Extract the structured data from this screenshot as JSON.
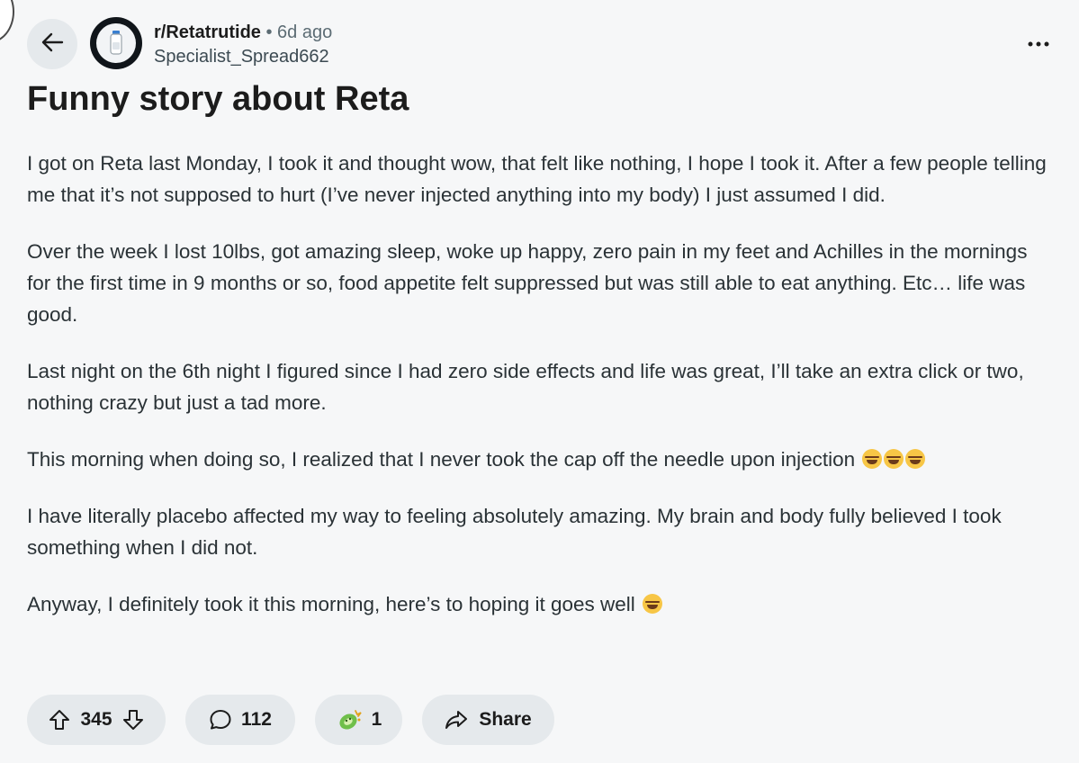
{
  "post": {
    "subreddit": "r/Retatrutide",
    "separator": "•",
    "age": "6d ago",
    "author": "Specialist_Spread662",
    "title": "Funny story about Reta",
    "paragraphs": [
      "I got on Reta last Monday, I took it and thought wow, that felt like nothing, I hope I took it. After a few people telling me that it’s not supposed to hurt (I’ve never injected anything into my body) I just assumed I did.",
      "Over the week I lost 10lbs, got amazing sleep, woke up happy, zero pain in my feet and Achilles in the mornings for the first time in 9 months or so, food appetite felt suppressed but was still able to eat anything. Etc… life was good.",
      "Last night on the 6th night I figured since I had zero side effects and life was great, I’ll take an extra click or two, nothing crazy but just a tad more.",
      "This morning when doing so, I realized that I never took the cap off the needle upon injection",
      "I have literally placebo affected my way to feeling absolutely amazing. My brain and body fully believed I took something when I did not.",
      "Anyway, I definitely took it this morning, here’s to hoping it goes well"
    ]
  },
  "actions": {
    "votes": "345",
    "comments": "112",
    "awards": "1",
    "share_label": "Share"
  },
  "icons": {
    "back": "arrow-left-icon",
    "more": "more-horizontal-icon",
    "upvote": "arrow-up-icon",
    "downvote": "arrow-down-icon",
    "comment": "speech-bubble-icon",
    "award": "award-icon",
    "share": "share-arrow-icon",
    "emoji_rofl": "rolling-laughing-emoji",
    "emoji_joy": "tears-of-joy-emoji"
  },
  "colors": {
    "background": "#f6f7f8",
    "pill": "#e5e9ec",
    "text": "#1c1c1c",
    "muted": "#5c6c74"
  }
}
